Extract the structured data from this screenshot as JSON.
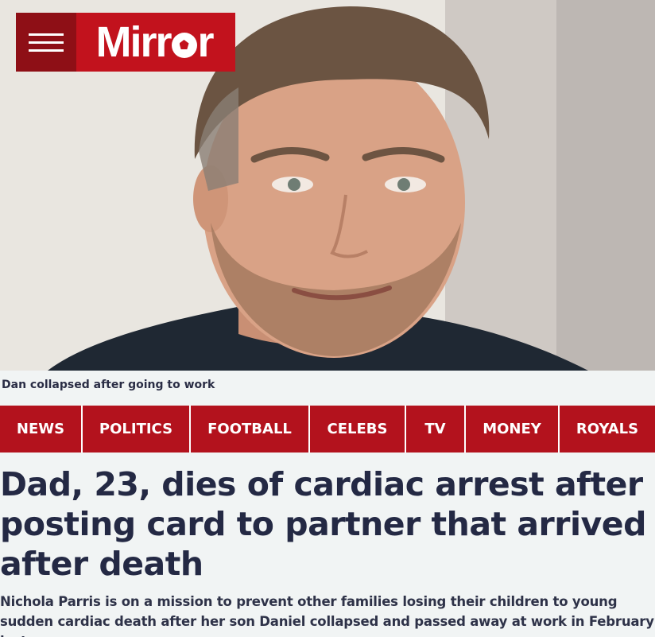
{
  "brand": {
    "name": "Mirror",
    "name_prefix": "Mirr",
    "name_suffix": "r",
    "primary_color": "#c2121d",
    "menu_color": "#8e0f16",
    "menu_icon": "hamburger-menu-icon",
    "logo_ball_icon": "football-icon"
  },
  "hero": {
    "caption": "Dan collapsed after going to work"
  },
  "nav": {
    "items": [
      {
        "label": "NEWS"
      },
      {
        "label": "POLITICS"
      },
      {
        "label": "FOOTBALL"
      },
      {
        "label": "CELEBS"
      },
      {
        "label": "TV"
      },
      {
        "label": "MONEY"
      },
      {
        "label": "ROYALS"
      }
    ],
    "background_color": "#b3121d"
  },
  "article": {
    "headline": "Dad, 23, dies of cardiac arrest after posting card to partner that arrived after death",
    "standfirst": "Nichola Parris is on a mission to prevent other families losing their children to young sudden cardiac death after her son Daniel collapsed and passed away at work in February last year"
  }
}
